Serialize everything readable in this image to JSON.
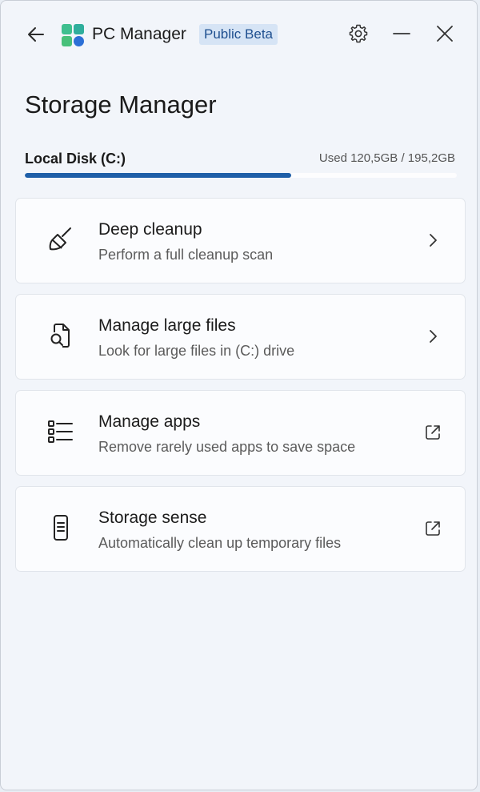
{
  "app": {
    "title": "PC Manager",
    "badge": "Public Beta",
    "icons": {
      "back": "back-arrow-icon",
      "logo": "pc-manager-logo",
      "settings": "gear-icon",
      "minimize": "minimize-icon",
      "close": "close-icon"
    }
  },
  "page": {
    "title": "Storage Manager"
  },
  "disk": {
    "label": "Local Disk (C:)",
    "usage_text": "Used 120,5GB / 195,2GB",
    "used_fraction": 0.617,
    "accent_color": "#1f5fa8"
  },
  "options": [
    {
      "title": "Deep cleanup",
      "description": "Perform a full cleanup scan",
      "icon": "broom-icon",
      "trail": "chevron-right-icon"
    },
    {
      "title": "Manage large files",
      "description": "Look for large files in (C:) drive",
      "icon": "file-search-icon",
      "trail": "chevron-right-icon"
    },
    {
      "title": "Manage apps",
      "description": "Remove rarely used apps to save space",
      "icon": "app-list-icon",
      "trail": "open-external-icon"
    },
    {
      "title": "Storage sense",
      "description": "Automatically clean up temporary files",
      "icon": "phone-storage-icon",
      "trail": "open-external-icon"
    }
  ]
}
